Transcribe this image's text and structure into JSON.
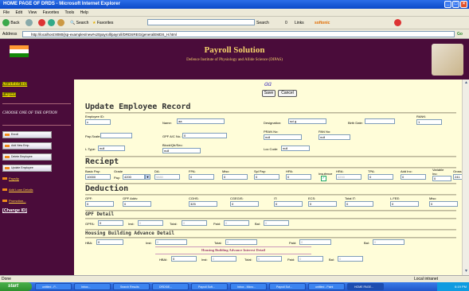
{
  "window": {
    "title": "HOME PAGE OF DRDS - Microsoft Internet Explorer"
  },
  "menu": [
    "File",
    "Edit",
    "View",
    "Favorites",
    "Tools",
    "Help"
  ],
  "toolbar": {
    "back": "Back",
    "search": "Search",
    "favorites": "Favorites",
    "search_box": "Search",
    "count": "0",
    "links": "Links",
    "softonic": "softonic"
  },
  "address": {
    "label": "Address",
    "url": "http://localhost:8080/jsp-examples/new%20payroll/payroll/DRDSREG/generalEMDS_H.html",
    "go": "Go"
  },
  "header": {
    "title": "Payroll Solution",
    "subtitle": "Defence Institute of Physiology and Allide Science (DIPAS)"
  },
  "sidebar": {
    "available": "Available ID:",
    "logout": "Logout",
    "choose": "CHOOSE ONE OF THE OPTION",
    "buttons": [
      "Enroll",
      "Add New Emp.",
      "Delete Employee",
      "Update Employee"
    ],
    "payslip": "Payslip",
    "addloan": "Add Loan Details",
    "promotion": "Promotion...",
    "change": "[Change ID]"
  },
  "main": {
    "name_display": "aa",
    "save": "Save",
    "cancel": "Cancel",
    "update_title": "Update Employee Record",
    "emp": {
      "id_label": "Employee ID:",
      "id": "c",
      "name_label": "Name:",
      "name": "aa",
      "desig_label": "Designation:",
      "desig": "sci g",
      "birth_label": "Birth Date:",
      "birth": "",
      "rank_label": "RANK:",
      "rank": "1",
      "payscale_label": "Pay-Scale:",
      "payscale": "",
      "gpf_label": "GPF A/C No.:",
      "gpf": "0",
      "pran_label": "PRAN No:",
      "pran": "null",
      "pan_label": "PAN No:",
      "pan": "null",
      "ltype_label": "L.Type:",
      "ltype": "null",
      "block_label": "Block/Qtr/Sec:",
      "block": "null",
      "loc_label": "Loc Code:",
      "loc": "null"
    },
    "receipt_title": "Reciept",
    "receipt": {
      "basic_label": "Basic Pay:",
      "basic": "10000",
      "grade_label": "Grade",
      "grade_pay_label": "Pay:",
      "grade": "4200",
      "da_label": "DA:",
      "da": "5880",
      "fpa_label": "FPA:",
      "fpa": "0",
      "misc_label": "Misc:",
      "misc": "0",
      "spl_label": "Spl Pay:",
      "spl": "0",
      "hpa_label": "HPA:",
      "hpa": "0",
      "insig_label": "Insufence",
      "hra_label": "HRA:",
      "hra": "4200",
      "tpa_label": "TPA:",
      "tpa": "0",
      "addinc_label": "Add Inc:",
      "addinc": "0",
      "var_label": "Variable Inc:",
      "var": "0",
      "gross_label": "Gross",
      "gross": "241"
    },
    "deduction_title": "Deduction",
    "deduction": {
      "gpf_label": "GPF:",
      "gpf": "0",
      "gpfadv_label": "GPF Addv:",
      "gpfadv": "0",
      "cghs_label": "CGHS:",
      "cghs": "325",
      "cggis_label": "CGEGIS:",
      "cggis": "0",
      "it_label": "IT:",
      "it": "0",
      "ecs_label": "ECS:",
      "ecs": "0",
      "totalit_label": "Total IT:",
      "totalit": "0",
      "lfee_label": "L.FEE:",
      "lfee": "0",
      "misc_label": "Misc:",
      "misc": "0"
    },
    "gpf_title": "GPF Detail",
    "gpf": {
      "gpfa_label": "GPFA:",
      "gpfa": "0",
      "inst_label": "Inst:",
      "inst": "0",
      "total_label": "Total:",
      "total": "0",
      "paid_label": "Paid:",
      "paid": "0",
      "bal_label": "Bal:",
      "bal": "0"
    },
    "hba_title": "Housing Building Advance Detail",
    "hba": {
      "hba_label": "HBA:",
      "hba": "0",
      "inst_label": "Inst:",
      "inst": "0",
      "total_label": "Total:",
      "total": "0",
      "paid_label": "Paid:",
      "paid": "0",
      "bal_label": "Bal:",
      "bal": "0"
    },
    "hbai_title": "Housing Building Advance Interest Detail",
    "hbai": {
      "hbai_label": "HBAI:",
      "hbai": "0",
      "inst_label": "Inst:",
      "inst": "0",
      "total_label": "Total:",
      "total": "0",
      "paid_label": "Paid:",
      "paid": "0",
      "bal_label": "Bal:",
      "bal": "0"
    }
  },
  "status": {
    "left": "Done",
    "right": "Local intranet"
  },
  "taskbar": {
    "start": "start",
    "tasks": [
      "untitled - P...",
      "Inbox...",
      "Search Results",
      "DRDSIE...",
      "Payroll Soft...",
      "Inbox - Micro...",
      "Payroll Sof...",
      "untitled - Paint",
      "HOME PAGE..."
    ],
    "time": "6:19 PM"
  }
}
